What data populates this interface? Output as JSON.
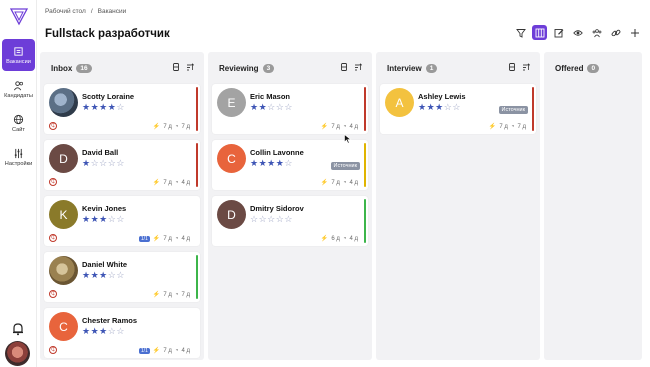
{
  "sidebar": {
    "items": [
      {
        "label": "Вакансии",
        "icon": "briefcase-icon",
        "active": true
      },
      {
        "label": "Кандидаты",
        "icon": "users-icon",
        "active": false
      },
      {
        "label": "Сайт",
        "icon": "globe-icon",
        "active": false
      },
      {
        "label": "Настройки",
        "icon": "sliders-icon",
        "active": false
      }
    ]
  },
  "breadcrumb": {
    "root": "Рабочий стол",
    "sep": "/",
    "current": "Вакансии"
  },
  "page": {
    "title": "Fullstack разработчик"
  },
  "colors": {
    "accent": "#6d3dd8",
    "star": "#3e55b5",
    "red": "#c0392b",
    "yellow": "#e0b400",
    "green": "#3cb54a"
  },
  "columns": [
    {
      "title": "Inbox",
      "count": "16",
      "cards": [
        {
          "name": "Scotty Loraine",
          "initial": "",
          "avatar": "photo1",
          "stars": 4,
          "source": "",
          "tag": "",
          "days1": "7 д",
          "days2": "7 д",
          "stripe": "red",
          "has_c": true
        },
        {
          "name": "David Ball",
          "initial": "D",
          "avatar": "#6b4a44",
          "stars": 1,
          "source": "",
          "tag": "",
          "days1": "7 д",
          "days2": "4 д",
          "stripe": "red",
          "has_c": true
        },
        {
          "name": "Kevin Jones",
          "initial": "K",
          "avatar": "#8a7a2a",
          "stars": 3,
          "source": "",
          "tag": "1/1",
          "days1": "7 д",
          "days2": "4 д",
          "stripe": "",
          "has_c": true
        },
        {
          "name": "Daniel White",
          "initial": "",
          "avatar": "photo2",
          "stars": 3,
          "source": "",
          "tag": "",
          "days1": "7 д",
          "days2": "7 д",
          "stripe": "green",
          "has_c": true
        },
        {
          "name": "Chester Ramos",
          "initial": "C",
          "avatar": "#e8643c",
          "stars": 3,
          "source": "",
          "tag": "1/1",
          "days1": "7 д",
          "days2": "4 д",
          "stripe": "",
          "has_c": true
        }
      ]
    },
    {
      "title": "Reviewing",
      "count": "3",
      "cards": [
        {
          "name": "Eric Mason",
          "initial": "E",
          "avatar": "#a3a3a3",
          "stars": 2,
          "source": "",
          "tag": "",
          "days1": "7 д",
          "days2": "4 д",
          "stripe": "red",
          "has_c": false
        },
        {
          "name": "Collin Lavonne",
          "initial": "C",
          "avatar": "#e8643c",
          "stars": 4,
          "source": "Источник",
          "tag": "",
          "days1": "7 д",
          "days2": "4 д",
          "stripe": "yellow",
          "has_c": false
        },
        {
          "name": "Dmitry Sidorov",
          "initial": "D",
          "avatar": "#6b4a44",
          "stars": 0,
          "source": "",
          "tag": "",
          "days1": "6 д",
          "days2": "4 д",
          "stripe": "green",
          "has_c": false
        }
      ]
    },
    {
      "title": "Interview",
      "count": "1",
      "cards": [
        {
          "name": "Ashley Lewis",
          "initial": "A",
          "avatar": "#f3c23f",
          "stars": 3,
          "source": "Источник",
          "tag": "",
          "days1": "7 д",
          "days2": "7 д",
          "stripe": "red",
          "has_c": false
        }
      ]
    },
    {
      "title": "Offered",
      "count": "0",
      "cards": []
    }
  ]
}
